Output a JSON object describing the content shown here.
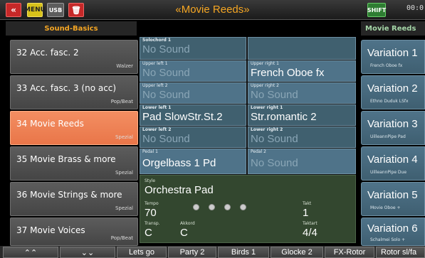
{
  "topbar": {
    "title": "«Movie Reeds»",
    "back_icon": "«",
    "menu_icon": "MENU",
    "usb_icon": "USB",
    "trash_icon": "🗑",
    "shift_icon": "SHIFT",
    "clock": "00:0"
  },
  "headers": {
    "left": "Sound-Basics",
    "right": "Movie Reeds"
  },
  "sound_basics": [
    {
      "name": "32 Acc. fasc. 2",
      "category": "Walzer",
      "active": false
    },
    {
      "name": "33 Acc. fasc. 3 (no acc)",
      "category": "Pop/Beat",
      "active": false
    },
    {
      "name": "34 Movie Reeds",
      "category": "Spezial",
      "active": true
    },
    {
      "name": "35 Movie Brass & more",
      "category": "Spezial",
      "active": false
    },
    {
      "name": "36 Movie Strings & more",
      "category": "Spezial",
      "active": false
    },
    {
      "name": "37 Movie Voices",
      "category": "Pop/Beat",
      "active": false
    }
  ],
  "registration": {
    "solochord": {
      "label": "Solochord 1",
      "value": "No Sound"
    },
    "upper_left_1": {
      "label": "Upper left 1",
      "value": "No Sound"
    },
    "upper_right_1": {
      "label": "Upper right 1",
      "value": "French Oboe   fx"
    },
    "upper_left_2": {
      "label": "Upper left 2",
      "value": "No Sound"
    },
    "upper_right_2": {
      "label": "Upper right 2",
      "value": "No Sound"
    },
    "lower_left_1": {
      "label": "Lower left 1",
      "value": "Pad SlowStr.St.2"
    },
    "lower_right_1": {
      "label": "Lower right 1",
      "value": "Str.romantic 2"
    },
    "lower_left_2": {
      "label": "Lower left 2",
      "value": "No Sound"
    },
    "lower_right_2": {
      "label": "Lower right 2",
      "value": "No Sound"
    },
    "pedal_1": {
      "label": "Pedal 1",
      "value": "Orgelbass 1  Pd"
    },
    "pedal_2": {
      "label": "Pedal 2",
      "value": "No Sound"
    }
  },
  "style": {
    "style_label": "Style",
    "style_value": "Orchestra Pad",
    "tempo_label": "Tempo",
    "tempo_value": "70",
    "takt_label": "Takt",
    "takt_value": "1",
    "transp_label": "Transp.",
    "transp_value": "C",
    "akkord_label": "Akkord",
    "akkord_value": "C",
    "taktart_label": "Taktart",
    "taktart_value": "4/4",
    "beat_dots": 4
  },
  "variations": [
    {
      "name": "Variation 1",
      "sub": "French Oboe   fx"
    },
    {
      "name": "Variation 2",
      "sub": "Ethno Duduk LSfx"
    },
    {
      "name": "Variation 3",
      "sub": "UilleannPipe Pad"
    },
    {
      "name": "Variation 4",
      "sub": "UilleannPipe Due"
    },
    {
      "name": "Variation 5",
      "sub": "Movie Oboe +"
    },
    {
      "name": "Variation 6",
      "sub": "Schalmei Solo +"
    }
  ],
  "bottom_bar": {
    "up_icon": "⌃⌃",
    "down_icon": "⌄⌄",
    "buttons": [
      "Lets go",
      "Party 2",
      "Birds 1",
      "Glocke 2",
      "FX-Rotor",
      "Rotor sl/fa"
    ]
  }
}
